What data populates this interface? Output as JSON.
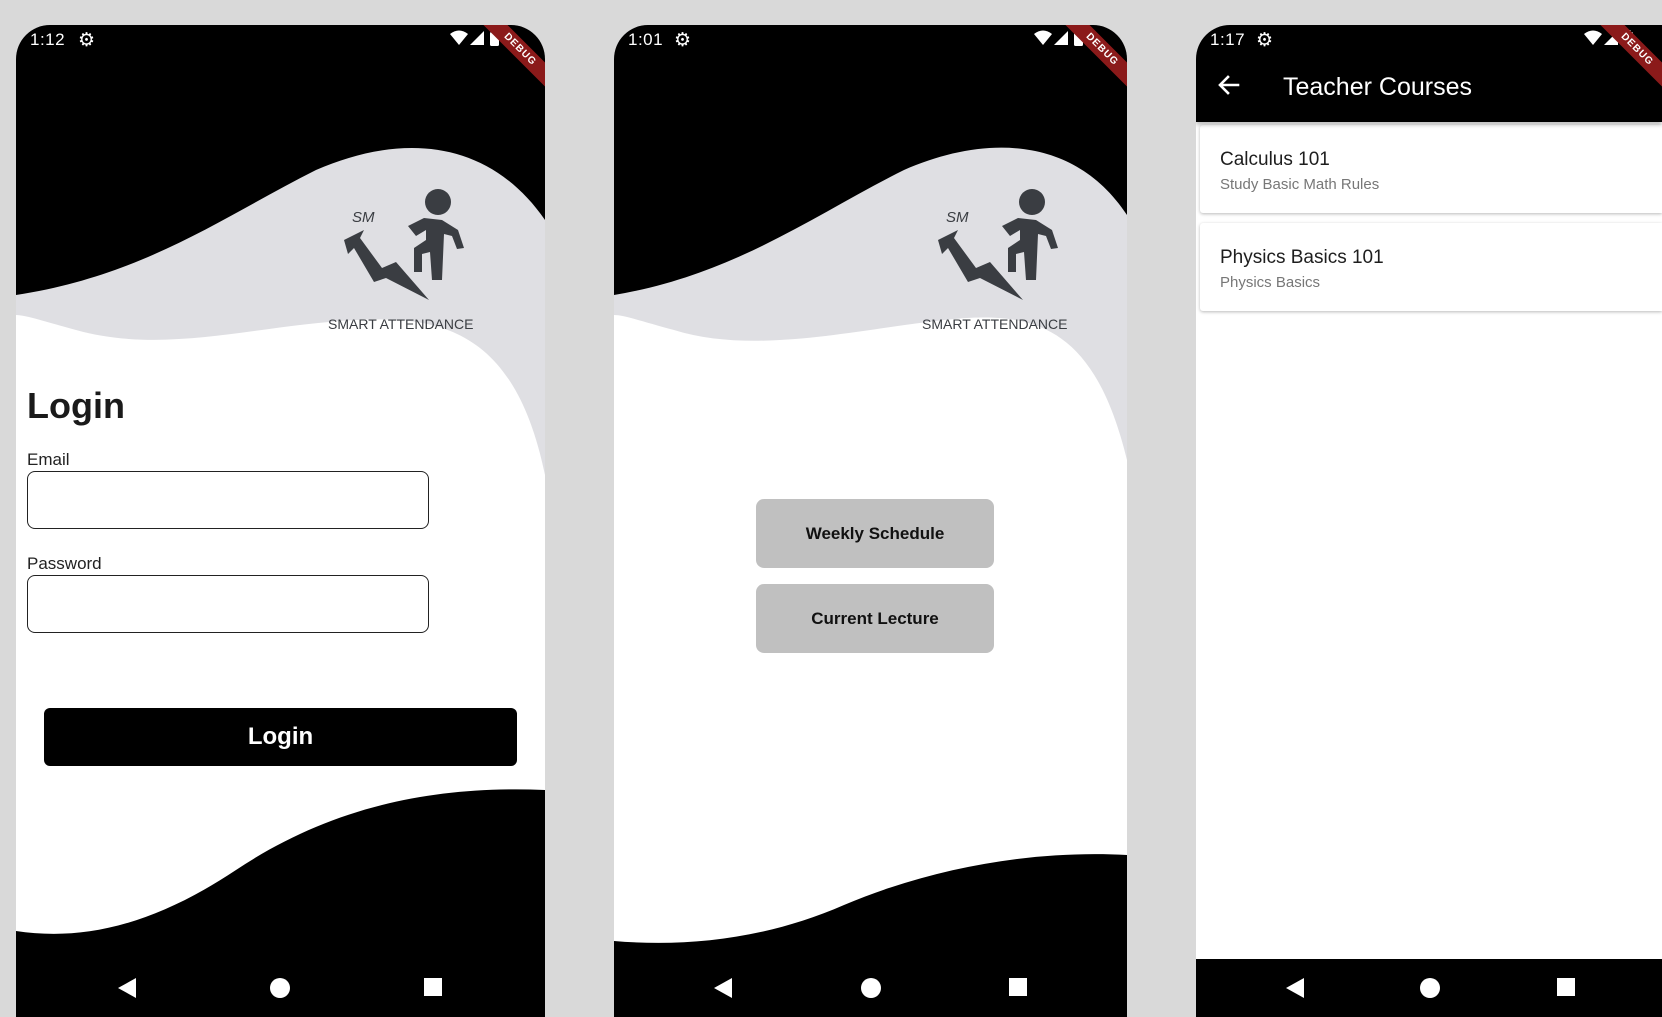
{
  "colors": {
    "screen_bg": "#d9d9d9",
    "black": "#000000",
    "wave_gray": "#dfdfe3",
    "logo_gray": "#3a3d42",
    "button_gray": "#c0c0c0",
    "debug_red": "#8b1a1a"
  },
  "icons": {
    "gear": "gear-icon",
    "wifi": "wifi-icon",
    "signal": "signal-icon",
    "battery": "battery-icon",
    "back_nav": "triangle-back-icon",
    "home_nav": "circle-home-icon",
    "recents_nav": "square-recents-icon",
    "arrow_back": "arrow-left-icon"
  },
  "logo": {
    "monogram": "SM",
    "name": "SMART ATTENDANCE"
  },
  "debug_label": "DEBUG",
  "login_screen": {
    "status_time": "1:12",
    "title": "Login",
    "email_label": "Email",
    "email_value": "",
    "password_label": "Password",
    "password_value": "",
    "login_button": "Login"
  },
  "menu_screen": {
    "status_time": "1:01",
    "weekly_schedule_button": "Weekly Schedule",
    "current_lecture_button": "Current Lecture"
  },
  "courses_screen": {
    "status_time": "1:17",
    "appbar_title": "Teacher Courses",
    "courses": [
      {
        "title": "Calculus 101",
        "subtitle": "Study Basic Math Rules"
      },
      {
        "title": "Physics Basics 101",
        "subtitle": "Physics Basics"
      }
    ]
  }
}
